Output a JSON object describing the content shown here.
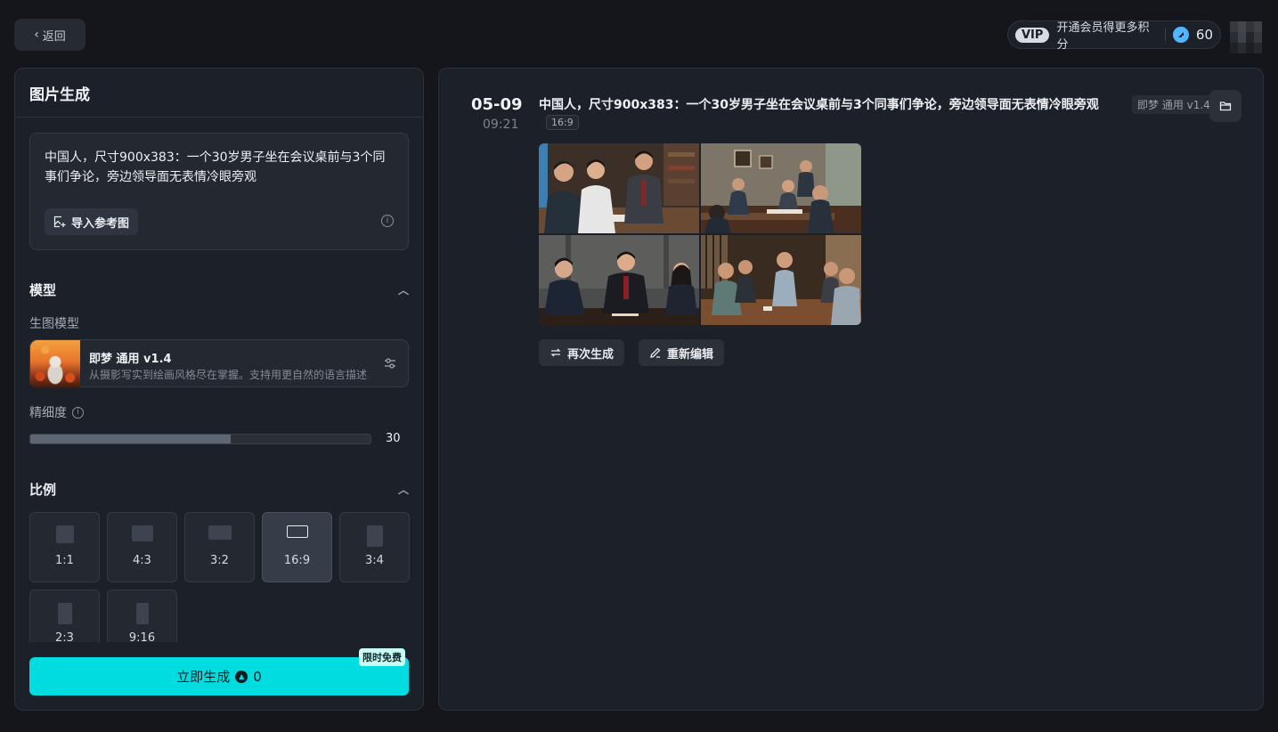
{
  "header": {
    "back_label": "返回",
    "vip_badge": "VIP",
    "vip_text": "开通会员得更多积分",
    "credits": "60"
  },
  "left": {
    "title": "图片生成",
    "prompt": "中国人，尺寸900x383：一个30岁男子坐在会议桌前与3个同事们争论，旁边领导面无表情冷眼旁观",
    "import_label": "导入参考图",
    "model_section": "模型",
    "model_sublabel": "生图模型",
    "model_name": "即梦 通用 v1.4",
    "model_desc": "从摄影写实到绘画风格尽在掌握。支持用更自然的语言描述",
    "detail_label": "精细度",
    "detail_value": "30",
    "detail_fraction": 0.59,
    "ratio_section": "比例",
    "ratios": [
      {
        "label": "1:1"
      },
      {
        "label": "4:3"
      },
      {
        "label": "3:2"
      },
      {
        "label": "16:9",
        "active": true
      },
      {
        "label": "3:4"
      },
      {
        "label": "2:3"
      },
      {
        "label": "9:16"
      }
    ],
    "generate_label": "立即生成",
    "generate_cost": "0",
    "free_tag": "限时免费"
  },
  "right": {
    "date": "05-09",
    "time": "09:21",
    "prompt": "中国人，尺寸900x383：一个30岁男子坐在会议桌前与3个同事们争论，旁边领导面无表情冷眼旁观",
    "model_tag": "即梦 通用 v1.4",
    "ratio_tag": "16:9",
    "regenerate_label": "再次生成",
    "reedit_label": "重新编辑"
  },
  "colors": {
    "accent": "#00dcdf",
    "background": "#14161b",
    "panel": "#1c2028"
  }
}
